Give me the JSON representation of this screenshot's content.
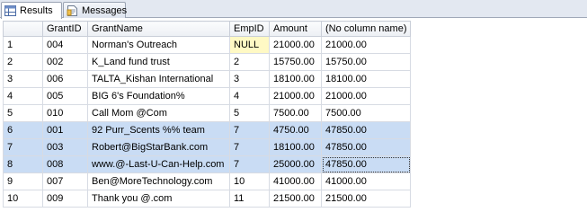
{
  "tabs": [
    {
      "label": "Results",
      "icon": "results-grid-icon",
      "active": true
    },
    {
      "label": "Messages",
      "icon": "messages-icon",
      "active": false
    }
  ],
  "grid": {
    "columns": [
      "",
      "GrantID",
      "GrantName",
      "EmpID",
      "Amount",
      "(No column name)"
    ],
    "rows": [
      {
        "num": "1",
        "GrantID": "004",
        "GrantName": "Norman's Outreach",
        "EmpID": "NULL",
        "Amount": "21000.00",
        "NoCol": "21000.00",
        "selected": false
      },
      {
        "num": "2",
        "GrantID": "002",
        "GrantName": "K_Land fund trust",
        "EmpID": "2",
        "Amount": "15750.00",
        "NoCol": "15750.00",
        "selected": false
      },
      {
        "num": "3",
        "GrantID": "006",
        "GrantName": "TALTA_Kishan International",
        "EmpID": "3",
        "Amount": "18100.00",
        "NoCol": "18100.00",
        "selected": false
      },
      {
        "num": "4",
        "GrantID": "005",
        "GrantName": "BIG 6's Foundation%",
        "EmpID": "4",
        "Amount": "21000.00",
        "NoCol": "21000.00",
        "selected": false
      },
      {
        "num": "5",
        "GrantID": "010",
        "GrantName": "Call Mom @Com",
        "EmpID": "5",
        "Amount": "7500.00",
        "NoCol": "7500.00",
        "selected": false
      },
      {
        "num": "6",
        "GrantID": "001",
        "GrantName": "92 Purr_Scents %% team",
        "EmpID": "7",
        "Amount": "4750.00",
        "NoCol": "47850.00",
        "selected": true
      },
      {
        "num": "7",
        "GrantID": "003",
        "GrantName": "Robert@BigStarBank.com",
        "EmpID": "7",
        "Amount": "18100.00",
        "NoCol": "47850.00",
        "selected": true
      },
      {
        "num": "8",
        "GrantID": "008",
        "GrantName": "www.@-Last-U-Can-Help.com",
        "EmpID": "7",
        "Amount": "25000.00",
        "NoCol": "47850.00",
        "selected": true
      },
      {
        "num": "9",
        "GrantID": "007",
        "GrantName": "Ben@MoreTechnology.com",
        "EmpID": "10",
        "Amount": "41000.00",
        "NoCol": "41000.00",
        "selected": false
      },
      {
        "num": "10",
        "GrantID": "009",
        "GrantName": "Thank you @.com",
        "EmpID": "11",
        "Amount": "21500.00",
        "NoCol": "21500.00",
        "selected": false
      }
    ]
  },
  "colors": {
    "selection": "#c9dcf4",
    "null_cell": "#fff9c4",
    "grid_line": "#d7dbe3"
  }
}
